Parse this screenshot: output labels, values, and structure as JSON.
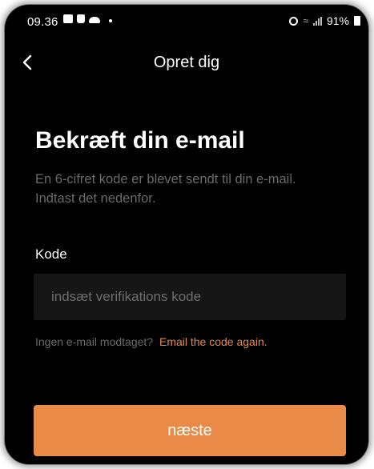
{
  "status_bar": {
    "time": "09.36",
    "battery": "91%",
    "icons_left": [
      "photo-icon",
      "bag-icon",
      "cloud-icon",
      "dot-icon"
    ],
    "icons_right": [
      "alarm-icon",
      "wifi-icon",
      "signal-icon",
      "battery-icon"
    ]
  },
  "header": {
    "title": "Opret dig",
    "back_icon": "chevron-left-icon"
  },
  "content": {
    "title": "Bekræft din e-mail",
    "description": "En 6-cifret kode er blevet sendt til din e-mail. Indtast det nedenfor.",
    "code_label": "Kode",
    "code_value": "",
    "code_placeholder": "indsæt verifikations kode",
    "resend_prompt": "Ingen e-mail modtaget?",
    "resend_link": "Email the code again."
  },
  "next_button": {
    "label": "næste"
  },
  "colors": {
    "background": "#000000",
    "accent": "#ea8a47",
    "muted_text": "#6a6a6a",
    "input_bg": "#161616"
  }
}
